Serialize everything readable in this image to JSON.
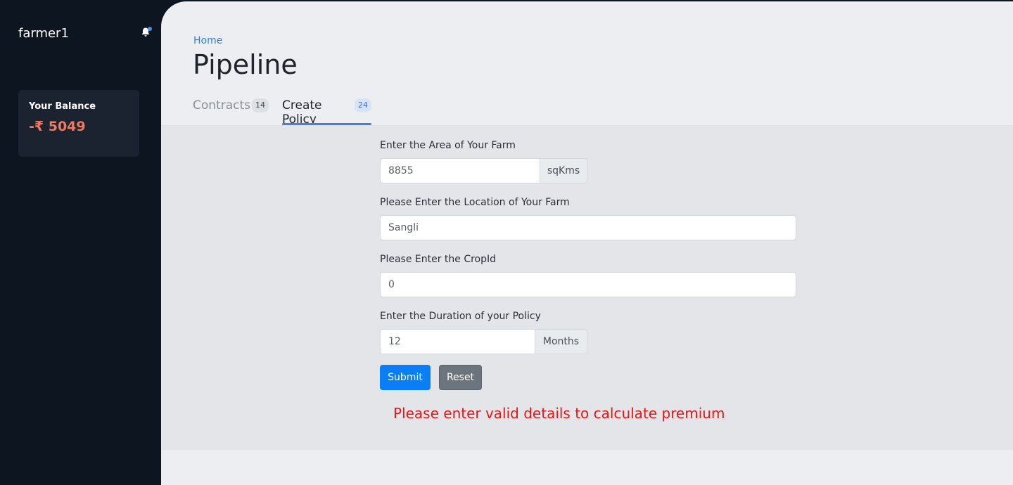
{
  "sidebar": {
    "username": "farmer1",
    "icons": {
      "notifications": "bell-icon"
    },
    "balance": {
      "label": "Your Balance",
      "value": "-₹ 5049"
    }
  },
  "header": {
    "breadcrumb": "Home",
    "title": "Pipeline"
  },
  "tabs": [
    {
      "label": "Contracts",
      "count": "14",
      "active": false
    },
    {
      "label": "Create Policy",
      "count": "24",
      "active": true
    }
  ],
  "form": {
    "area": {
      "label": "Enter the Area of Your Farm",
      "value": "8855",
      "unit": "sqKms"
    },
    "location": {
      "label": "Please Enter the Location of Your Farm",
      "value": "Sangli"
    },
    "crop": {
      "label": "Please Enter the CropId",
      "value": "0"
    },
    "duration": {
      "label": "Enter the Duration of your Policy",
      "value": "12",
      "unit": "Months"
    },
    "submit_label": "Submit",
    "reset_label": "Reset",
    "error": "Please enter valid details to calculate premium"
  },
  "colors": {
    "accent": "#0a7ff5",
    "error": "#e81515",
    "balance": "#f07a5e"
  }
}
